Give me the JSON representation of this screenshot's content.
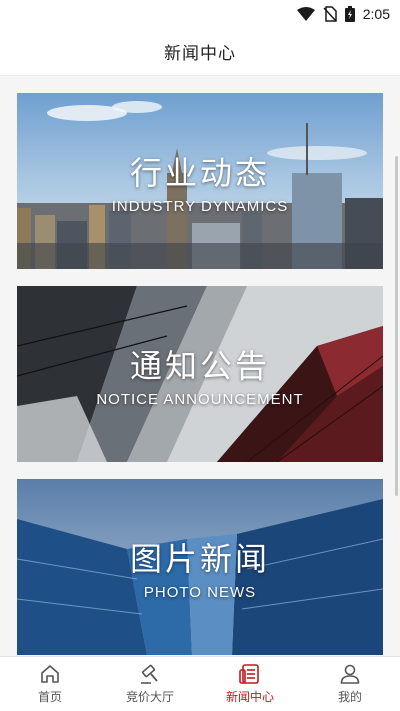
{
  "status": {
    "time": "2:05"
  },
  "header": {
    "title": "新闻中心"
  },
  "cards": [
    {
      "title_cn": "行业动态",
      "title_en": "INDUSTRY DYNAMICS"
    },
    {
      "title_cn": "通知公告",
      "title_en": "NOTICE ANNOUNCEMENT"
    },
    {
      "title_cn": "图片新闻",
      "title_en": "PHOTO NEWS"
    }
  ],
  "tabbar": {
    "items": [
      {
        "label": "首页",
        "icon": "home-icon"
      },
      {
        "label": "竞价大厅",
        "icon": "gavel-icon"
      },
      {
        "label": "新闻中心",
        "icon": "news-icon",
        "active": true
      },
      {
        "label": "我的",
        "icon": "user-icon"
      }
    ],
    "active_color": "#c8161d",
    "inactive_color": "#555555"
  }
}
